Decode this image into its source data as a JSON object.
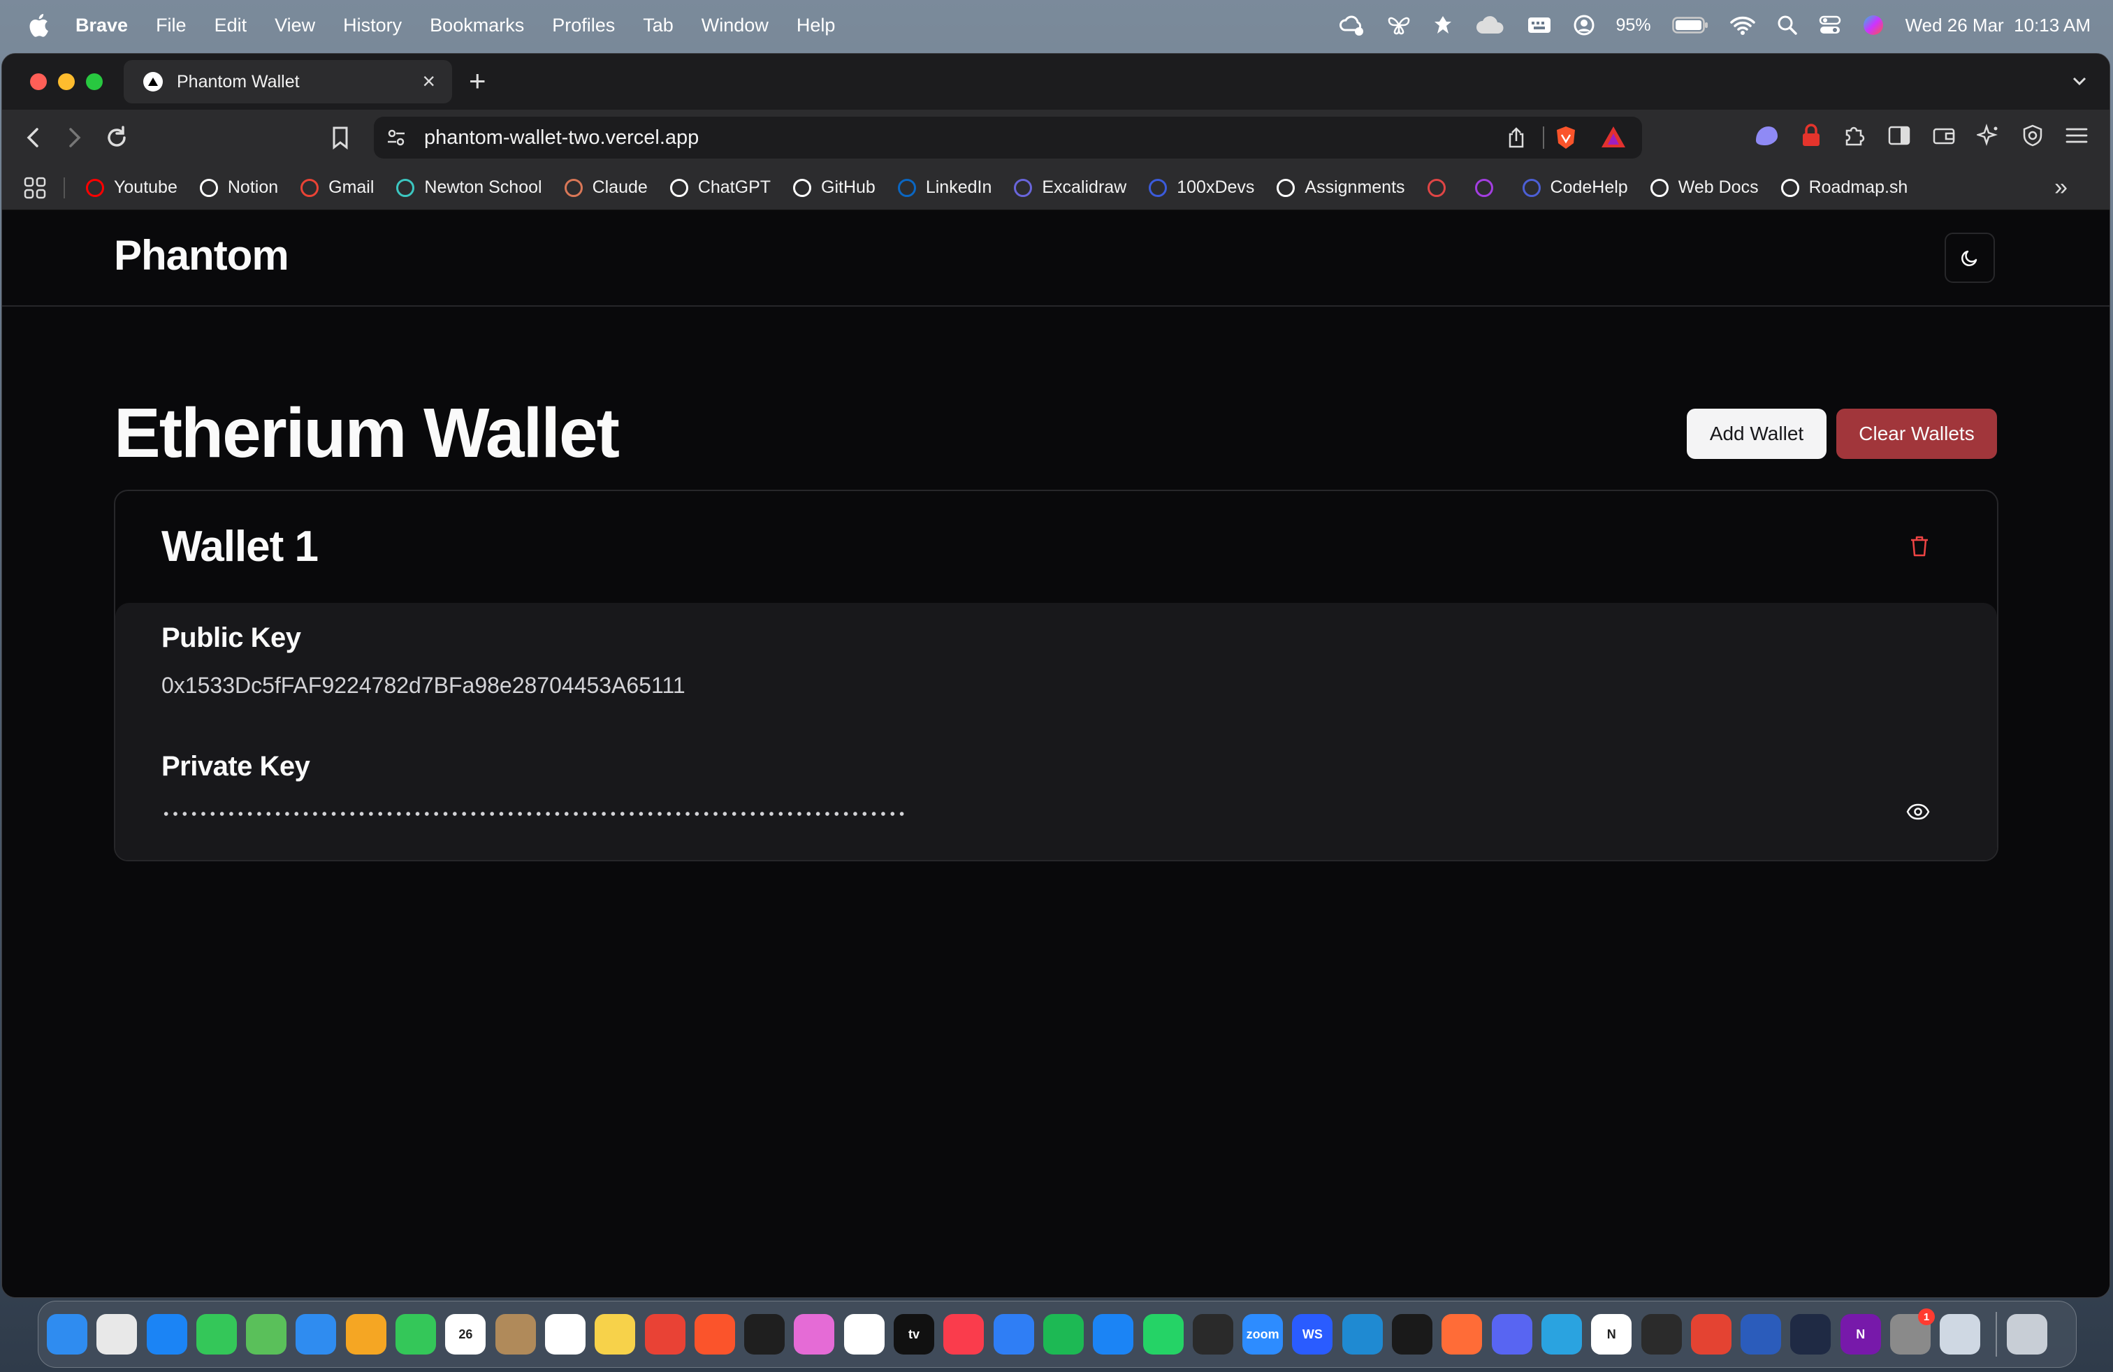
{
  "menubar": {
    "app": "Brave",
    "items": [
      "File",
      "Edit",
      "View",
      "History",
      "Bookmarks",
      "Profiles",
      "Tab",
      "Window",
      "Help"
    ],
    "battery": "95%",
    "datetime": "Wed 26 Mar  10:13 AM"
  },
  "browser": {
    "tab_title": "Phantom Wallet",
    "url": "phantom-wallet-two.vercel.app",
    "bookmarks": [
      {
        "label": "Youtube",
        "icon": "youtube-icon",
        "color": "#ff0000"
      },
      {
        "label": "Notion",
        "icon": "notion-icon",
        "color": "#ffffff"
      },
      {
        "label": "Gmail",
        "icon": "gmail-icon",
        "color": "#ea4335"
      },
      {
        "label": "Newton School",
        "icon": "newton-school-icon",
        "color": "#3cc7c1"
      },
      {
        "label": "Claude",
        "icon": "claude-icon",
        "color": "#d97757"
      },
      {
        "label": "ChatGPT",
        "icon": "chatgpt-icon",
        "color": "#ffffff"
      },
      {
        "label": "GitHub",
        "icon": "github-icon",
        "color": "#ffffff"
      },
      {
        "label": "LinkedIn",
        "icon": "linkedin-icon",
        "color": "#0a66c2"
      },
      {
        "label": "Excalidraw",
        "icon": "excalidraw-icon",
        "color": "#6965db"
      },
      {
        "label": "100xDevs",
        "icon": "100xdevs-icon",
        "color": "#3b5bdb"
      },
      {
        "label": "Assignments",
        "icon": "github-icon",
        "color": "#ffffff"
      },
      {
        "label": "",
        "icon": "codeforces-icon",
        "color": "#e04545"
      },
      {
        "label": "",
        "icon": "gradient-icon",
        "color": "#a33ee0"
      },
      {
        "label": "CodeHelp",
        "icon": "codehelp-icon",
        "color": "#4c5fd5"
      },
      {
        "label": "Web Docs",
        "icon": "mdn-icon",
        "color": "#ffffff"
      },
      {
        "label": "Roadmap.sh",
        "icon": "roadmap-icon",
        "color": "#ffffff"
      }
    ]
  },
  "app": {
    "brand": "Phantom",
    "title": "Etherium Wallet",
    "add_wallet": "Add Wallet",
    "clear_wallets": "Clear Wallets",
    "wallet": {
      "name": "Wallet 1",
      "public_key_label": "Public Key",
      "public_key": "0x1533Dc5fFAF9224782d7BFa98e28704453A65111",
      "private_key_label": "Private Key"
    }
  },
  "colors": {
    "background": "#09090b",
    "card_body": "#18181b",
    "border": "#27272a",
    "destructive": "#a1363b",
    "trash_icon": "#ef4444"
  },
  "dock": [
    {
      "icon": "finder-icon",
      "color": "#2f8cf0"
    },
    {
      "icon": "launchpad-icon",
      "color": "#e8e8e8"
    },
    {
      "icon": "safari-icon",
      "color": "#1b84f5"
    },
    {
      "icon": "messages-icon",
      "color": "#34c759"
    },
    {
      "icon": "maps-icon",
      "color": "#5ac05a"
    },
    {
      "icon": "mail-icon",
      "color": "#2f8cf0"
    },
    {
      "icon": "photos-icon",
      "color": "#f5a623"
    },
    {
      "icon": "facetime-icon",
      "color": "#34c759"
    },
    {
      "icon": "calendar-icon",
      "color": "#ffffff",
      "text": "26"
    },
    {
      "icon": "contacts-icon",
      "color": "#b08a5a"
    },
    {
      "icon": "reminders-icon",
      "color": "#ffffff"
    },
    {
      "icon": "notes-icon",
      "color": "#f7d24a"
    },
    {
      "icon": "chrome-icon",
      "color": "#e94235"
    },
    {
      "icon": "brave-icon",
      "color": "#fb542b"
    },
    {
      "icon": "perplexity-icon",
      "color": "#1f1f1f"
    },
    {
      "icon": "arc-icon",
      "color": "#e56bd6"
    },
    {
      "icon": "freeform-icon",
      "color": "#ffffff"
    },
    {
      "icon": "apple-tv-icon",
      "color": "#111111",
      "text": "tv"
    },
    {
      "icon": "music-icon",
      "color": "#fa3c4c"
    },
    {
      "icon": "keynote-icon",
      "color": "#2f7ef5"
    },
    {
      "icon": "spotify-icon",
      "color": "#1db954"
    },
    {
      "icon": "app-store-icon",
      "color": "#1b84f5"
    },
    {
      "icon": "whatsapp-icon",
      "color": "#25d366"
    },
    {
      "icon": "capcut-icon",
      "color": "#2a2a2a"
    },
    {
      "icon": "zoom-icon",
      "color": "#2d8cff",
      "text": "zoom"
    },
    {
      "icon": "webstorm-icon",
      "color": "#2a5cff",
      "text": "WS"
    },
    {
      "icon": "vscode-icon",
      "color": "#1f8ad2"
    },
    {
      "icon": "cursor-icon",
      "color": "#1a1a1a"
    },
    {
      "icon": "postman-icon",
      "color": "#ff6c37"
    },
    {
      "icon": "discord-icon",
      "color": "#5865f2"
    },
    {
      "icon": "telegram-icon",
      "color": "#2aa3e0"
    },
    {
      "icon": "notion-icon",
      "color": "#ffffff",
      "text": "N"
    },
    {
      "icon": "linear-icon",
      "color": "#2b2b2b"
    },
    {
      "icon": "todoist-icon",
      "color": "#e44332"
    },
    {
      "icon": "word-icon",
      "color": "#2b5cbb"
    },
    {
      "icon": "terminal-icon",
      "color": "#1f2a44"
    },
    {
      "icon": "onenote-icon",
      "color": "#7719aa",
      "text": "N"
    },
    {
      "icon": "system-settings-icon",
      "color": "#8a8a8a",
      "badge": "1"
    },
    {
      "icon": "preview-icon",
      "color": "#cfd8e3"
    },
    {
      "icon": "trash-icon",
      "color": "#c8ced6"
    }
  ]
}
